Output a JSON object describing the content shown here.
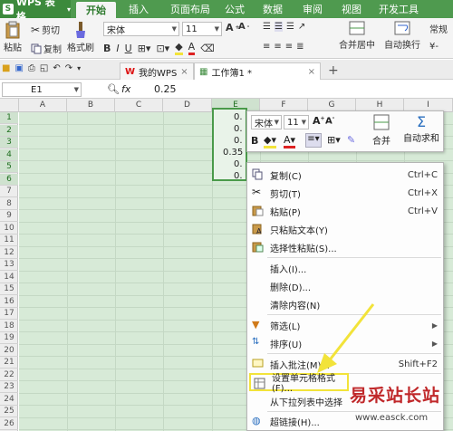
{
  "app": {
    "menu_label": "WPS 表格"
  },
  "ribbon_tabs": [
    "开始",
    "插入",
    "页面布局",
    "公式",
    "数据",
    "审阅",
    "视图",
    "开发工具"
  ],
  "ribbon": {
    "paste": "粘贴",
    "cut": "剪切",
    "copy": "复制",
    "format_painter": "格式刷",
    "font_name": "宋体",
    "font_size": "11",
    "merge_center": "合并居中",
    "auto_wrap": "自动换行",
    "number_format": "常规"
  },
  "doc_tabs": [
    {
      "label": "我的WPS",
      "active": false
    },
    {
      "label": "工作簿1 *",
      "active": true
    }
  ],
  "formula_bar": {
    "cell_ref": "E1",
    "fx": "fx",
    "value": "0.25"
  },
  "columns": [
    "A",
    "B",
    "C",
    "D",
    "E",
    "F",
    "G",
    "H",
    "I"
  ],
  "rows": [
    "1",
    "2",
    "3",
    "4",
    "5",
    "6",
    "7",
    "8",
    "9",
    "10",
    "11",
    "12",
    "13",
    "14",
    "15",
    "16",
    "17",
    "18",
    "19",
    "20",
    "21",
    "22",
    "23",
    "24",
    "25",
    "26"
  ],
  "cell_values": [
    "0.",
    "0.",
    "0.",
    "0.35",
    "0.",
    "0."
  ],
  "mini_toolbar": {
    "font_name": "宋体",
    "font_size": "11",
    "merge": "合并",
    "autosum": "自动求和",
    "sigma": "Σ"
  },
  "context_menu": [
    {
      "label": "复制(C)",
      "shortcut": "Ctrl+C"
    },
    {
      "label": "剪切(T)",
      "shortcut": "Ctrl+X"
    },
    {
      "label": "粘贴(P)",
      "shortcut": "Ctrl+V"
    },
    {
      "label": "只粘贴文本(Y)",
      "shortcut": ""
    },
    {
      "label": "选择性粘贴(S)...",
      "shortcut": ""
    },
    {
      "label": "插入(I)...",
      "shortcut": ""
    },
    {
      "label": "删除(D)...",
      "shortcut": ""
    },
    {
      "label": "清除内容(N)",
      "shortcut": ""
    },
    {
      "label": "筛选(L)",
      "shortcut": ""
    },
    {
      "label": "排序(U)",
      "shortcut": ""
    },
    {
      "label": "插入批注(M)...",
      "shortcut": "Shift+F2"
    },
    {
      "label": "设置单元格格式(F)...",
      "shortcut": ""
    },
    {
      "label": "从下拉列表中选择",
      "shortcut": ""
    },
    {
      "label": "超链接(H)...",
      "shortcut": ""
    }
  ],
  "watermark": {
    "text": "易采站长站",
    "url": "www.easck.com"
  },
  "colors": {
    "ribbon_green": "#4f9a4f",
    "selection_fill": "#d7ead7",
    "highlight": "#f2e33a"
  }
}
